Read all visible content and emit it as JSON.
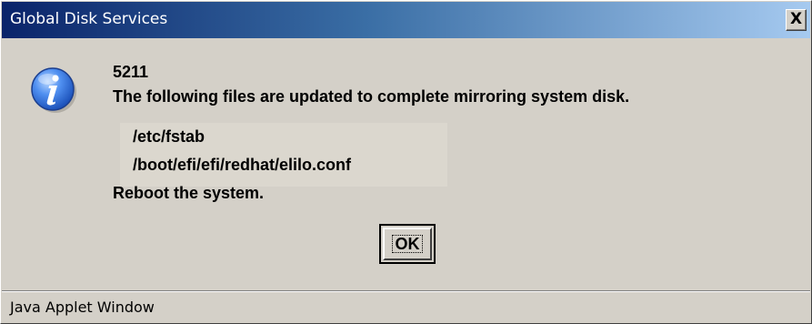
{
  "window": {
    "title": "Global Disk Services",
    "close_label": "X",
    "status_text": "Java Applet Window"
  },
  "colors": {
    "titlebar_start": "#0a246a",
    "titlebar_end": "#a6caf0",
    "face": "#d4d0c8",
    "icon_blue": "#2a63d6"
  },
  "dialog": {
    "icon": "info-icon",
    "code": "5211",
    "message": "The following files are updated to complete mirroring system disk.",
    "files": [
      "/etc/fstab",
      "/boot/efi/efi/redhat/elilo.conf"
    ],
    "instruction": "Reboot the system.",
    "ok_label": "OK"
  }
}
